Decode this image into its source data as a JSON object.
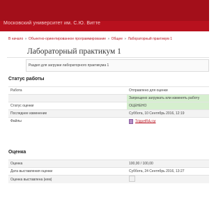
{
  "header": {
    "site_title": "Московский университет им. С.Ю. Витте",
    "brand_color": "#b8111e"
  },
  "breadcrumb": {
    "items": [
      "В начало",
      "Объектно-ориентированное программирование",
      "Общее",
      "Лабораторный практикум 1"
    ],
    "separator": "»"
  },
  "page": {
    "title": "Лабораторный практикум 1",
    "intro": "Раздел для загрузки лабораторного практикума 1"
  },
  "submission_status": {
    "heading": "Статус работы",
    "rows": [
      {
        "label": "Работа",
        "value": "Отправлено для оценки"
      },
      {
        "label": "",
        "value": "Запрещено загружать или изменять работу"
      },
      {
        "label": "Статус оценки",
        "value": "ОЦЕНЕНО"
      },
      {
        "label": "Последнее изменение",
        "value": "Суббота, 10 Сентябрь 2016, 12:19"
      },
      {
        "label": "Файлы",
        "value": "TrippelRA.rar",
        "icon": "archive-file-icon"
      }
    ]
  },
  "grade": {
    "heading": "Оценка",
    "rows": [
      {
        "label": "Оценка",
        "value": "100,00 / 100,00"
      },
      {
        "label": "Дата выставления оценки",
        "value": "Суббота, 24 Сентябрь 2016, 13:27"
      },
      {
        "label": "Оценка выставлена (кем)",
        "value": "",
        "icon": "avatar-icon"
      }
    ]
  }
}
